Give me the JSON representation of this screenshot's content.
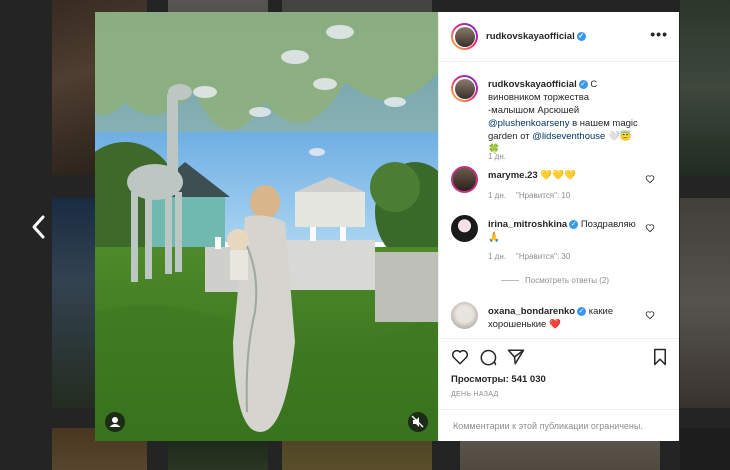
{
  "navigation": {
    "prev_label": "Назад"
  },
  "post": {
    "author": "rudkovskayaofficial",
    "menu_label": "•••",
    "caption": {
      "author": "rudkovskayaofficial",
      "text_1": "С виновником торжества -малышом Арсюшей",
      "mention_1": "@plushenkoarseny",
      "text_2": "в нашем magic garden от",
      "mention_2": "@lidseventhouse",
      "emoji": "🤍😇🍀",
      "time": "1 дн."
    },
    "comments": [
      {
        "user": "maryme.23",
        "verified": false,
        "text": "💛💛💛",
        "time": "1 дн.",
        "likes": "\"Нравится\": 10",
        "reply": ""
      },
      {
        "user": "irina_mitroshkina",
        "verified": true,
        "text": "Поздравляю",
        "text_2": "🙏",
        "time": "1 дн.",
        "likes": "\"Нравится\": 30",
        "reply": ""
      },
      {
        "user": "oxana_bondarenko",
        "verified": true,
        "text": "какие хорошенькие",
        "emoji": "❤️",
        "time": "",
        "likes": "",
        "reply": ""
      }
    ],
    "replies_label": "Посмотреть ответы (2)",
    "views": "Просмотры: 541 030",
    "posted_ago": "ДЕНЬ НАЗАД",
    "comments_limited": "Комментарии к этой публикации ограничены."
  },
  "colors": {
    "accent_link": "#00376b",
    "verified": "#3897f0",
    "muted": "#8e8e8e"
  }
}
